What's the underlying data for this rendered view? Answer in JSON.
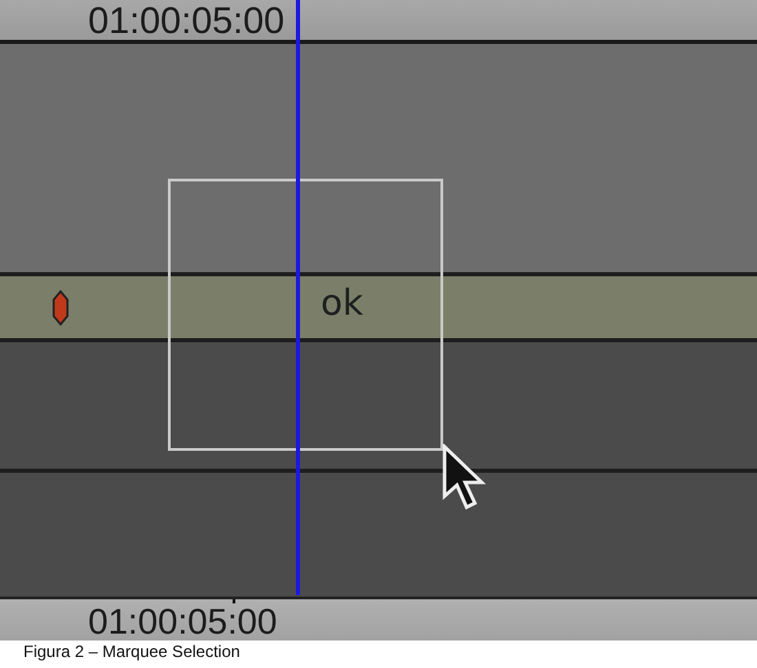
{
  "top_ruler": {
    "timecode": "01:00:05:00"
  },
  "marker_track": {
    "clip_label": "ok"
  },
  "bottom_ruler": {
    "timecode": "01:00:05:00"
  },
  "caption": "Figura 2 – Marquee Selection"
}
